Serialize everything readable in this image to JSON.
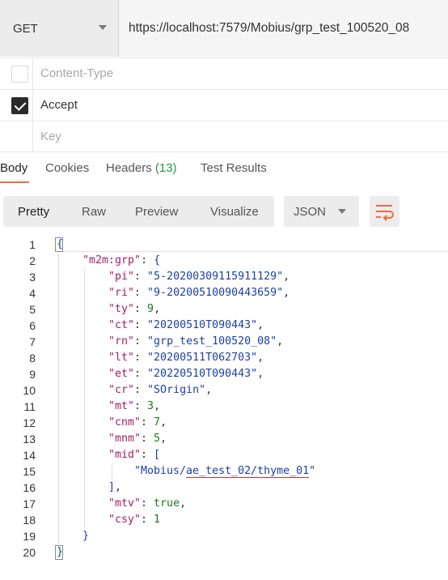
{
  "request": {
    "method": "GET",
    "url": "https://localhost:7579/Mobius/grp_test_100520_08"
  },
  "headers": [
    {
      "key": "Content-Type",
      "checked": false,
      "dim": true
    },
    {
      "key": "Accept",
      "checked": true,
      "dim": false
    },
    {
      "key": "Key",
      "checked": false,
      "dim": true,
      "placeholder": true
    }
  ],
  "tabs": {
    "body": "Body",
    "cookies": "Cookies",
    "headers": "Headers",
    "headers_count": "(13)",
    "tests": "Test Results"
  },
  "toolbar": {
    "pretty": "Pretty",
    "raw": "Raw",
    "preview": "Preview",
    "visualize": "Visualize",
    "format": "JSON",
    "wrap_icon": "wrap-lines-icon"
  },
  "code": {
    "lines": [
      {
        "n": "1",
        "indent": 0,
        "parts": [
          [
            "b",
            "{"
          ]
        ]
      },
      {
        "n": "2",
        "indent": 1,
        "parts": [
          [
            "k",
            "\"m2m:grp\""
          ],
          [
            "p",
            ": "
          ],
          [
            "b",
            "{"
          ]
        ]
      },
      {
        "n": "3",
        "indent": 2,
        "parts": [
          [
            "k",
            "\"pi\""
          ],
          [
            "p",
            ": "
          ],
          [
            "s",
            "\"5-20200309115911129\""
          ],
          [
            "p",
            ","
          ]
        ]
      },
      {
        "n": "4",
        "indent": 2,
        "parts": [
          [
            "k",
            "\"ri\""
          ],
          [
            "p",
            ": "
          ],
          [
            "s",
            "\"9-20200510090443659\""
          ],
          [
            "p",
            ","
          ]
        ]
      },
      {
        "n": "5",
        "indent": 2,
        "parts": [
          [
            "k",
            "\"ty\""
          ],
          [
            "p",
            ": "
          ],
          [
            "n",
            "9"
          ],
          [
            "p",
            ","
          ]
        ]
      },
      {
        "n": "6",
        "indent": 2,
        "parts": [
          [
            "k",
            "\"ct\""
          ],
          [
            "p",
            ": "
          ],
          [
            "s",
            "\"20200510T090443\""
          ],
          [
            "p",
            ","
          ]
        ]
      },
      {
        "n": "7",
        "indent": 2,
        "parts": [
          [
            "k",
            "\"rn\""
          ],
          [
            "p",
            ": "
          ],
          [
            "s",
            "\"grp_test_100520_08\""
          ],
          [
            "p",
            ","
          ]
        ]
      },
      {
        "n": "8",
        "indent": 2,
        "parts": [
          [
            "k",
            "\"lt\""
          ],
          [
            "p",
            ": "
          ],
          [
            "s",
            "\"20200511T062703\""
          ],
          [
            "p",
            ","
          ]
        ]
      },
      {
        "n": "9",
        "indent": 2,
        "parts": [
          [
            "k",
            "\"et\""
          ],
          [
            "p",
            ": "
          ],
          [
            "s",
            "\"20220510T090443\""
          ],
          [
            "p",
            ","
          ]
        ]
      },
      {
        "n": "10",
        "indent": 2,
        "parts": [
          [
            "k",
            "\"cr\""
          ],
          [
            "p",
            ": "
          ],
          [
            "s",
            "\"SOrigin\""
          ],
          [
            "p",
            ","
          ]
        ]
      },
      {
        "n": "11",
        "indent": 2,
        "parts": [
          [
            "k",
            "\"mt\""
          ],
          [
            "p",
            ": "
          ],
          [
            "n",
            "3"
          ],
          [
            "p",
            ","
          ]
        ]
      },
      {
        "n": "12",
        "indent": 2,
        "parts": [
          [
            "k",
            "\"cnm\""
          ],
          [
            "p",
            ": "
          ],
          [
            "n",
            "7"
          ],
          [
            "p",
            ","
          ]
        ]
      },
      {
        "n": "13",
        "indent": 2,
        "parts": [
          [
            "k",
            "\"mnm\""
          ],
          [
            "p",
            ": "
          ],
          [
            "n",
            "5"
          ],
          [
            "p",
            ","
          ]
        ]
      },
      {
        "n": "14",
        "indent": 2,
        "parts": [
          [
            "k",
            "\"mid\""
          ],
          [
            "p",
            ": "
          ],
          [
            "b",
            "["
          ]
        ]
      },
      {
        "n": "15",
        "indent": 3,
        "parts": [
          [
            "s",
            "\"Mobius/"
          ],
          [
            "su",
            "ae_test_02/thyme_01"
          ],
          [
            "s",
            "\""
          ]
        ]
      },
      {
        "n": "16",
        "indent": 2,
        "parts": [
          [
            "b",
            "]"
          ],
          [
            "p",
            ","
          ]
        ]
      },
      {
        "n": "17",
        "indent": 2,
        "parts": [
          [
            "k",
            "\"mtv\""
          ],
          [
            "p",
            ": "
          ],
          [
            "n",
            "true"
          ],
          [
            "p",
            ","
          ]
        ]
      },
      {
        "n": "18",
        "indent": 2,
        "parts": [
          [
            "k",
            "\"csy\""
          ],
          [
            "p",
            ": "
          ],
          [
            "n",
            "1"
          ]
        ]
      },
      {
        "n": "19",
        "indent": 1,
        "parts": [
          [
            "b",
            "}"
          ]
        ]
      },
      {
        "n": "20",
        "indent": 0,
        "parts": [
          [
            "b",
            "}"
          ]
        ]
      }
    ]
  }
}
